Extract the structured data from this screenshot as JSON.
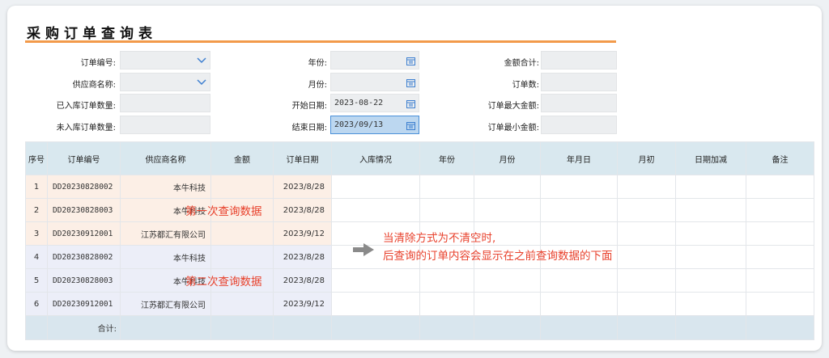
{
  "title": "采购订单查询表",
  "form": {
    "order_no_label": "订单编号:",
    "supplier_label": "供应商名称:",
    "stocked_count_label": "已入库订单数量:",
    "unstocked_count_label": "未入库订单数量:",
    "year_label": "年份:",
    "month_label": "月份:",
    "start_date_label": "开始日期:",
    "start_date_value": "2023-08-22",
    "end_date_label": "结束日期:",
    "end_date_value": "2023/09/13",
    "amount_total_label": "金额合计:",
    "order_count_label": "订单数:",
    "max_amount_label": "订单最大金额:",
    "min_amount_label": "订单最小金额:"
  },
  "table": {
    "headers": [
      "序号",
      "订单编号",
      "供应商名称",
      "金额",
      "订单日期",
      "入库情况",
      "年份",
      "月份",
      "年月日",
      "月初",
      "日期加减",
      "备注"
    ],
    "rows": [
      {
        "seq": "1",
        "order_no": "DD20230828002",
        "supplier": "本牛科技",
        "date": "2023/8/28"
      },
      {
        "seq": "2",
        "order_no": "DD20230828003",
        "supplier": "本牛科技",
        "date": "2023/8/28"
      },
      {
        "seq": "3",
        "order_no": "DD20230912001",
        "supplier": "江苏都汇有限公司",
        "date": "2023/9/12"
      },
      {
        "seq": "4",
        "order_no": "DD20230828002",
        "supplier": "本牛科技",
        "date": "2023/8/28"
      },
      {
        "seq": "5",
        "order_no": "DD20230828003",
        "supplier": "本牛科技",
        "date": "2023/8/28"
      },
      {
        "seq": "6",
        "order_no": "DD20230912001",
        "supplier": "江苏都汇有限公司",
        "date": "2023/9/12"
      }
    ],
    "total_label": "合计:"
  },
  "annotations": {
    "first_query": "第一次查询数据",
    "second_query": "第二次查询数据",
    "note_line1": "当清除方式为不清空时,",
    "note_line2": "后查询的订单内容会显示在之前查询数据的下面"
  },
  "colors": {
    "accent_line": "#f29a4a",
    "header_bg": "#d9e8ef",
    "group1_bg": "#fcefe6",
    "group2_bg": "#eceef8",
    "note_red": "#e8412c"
  }
}
